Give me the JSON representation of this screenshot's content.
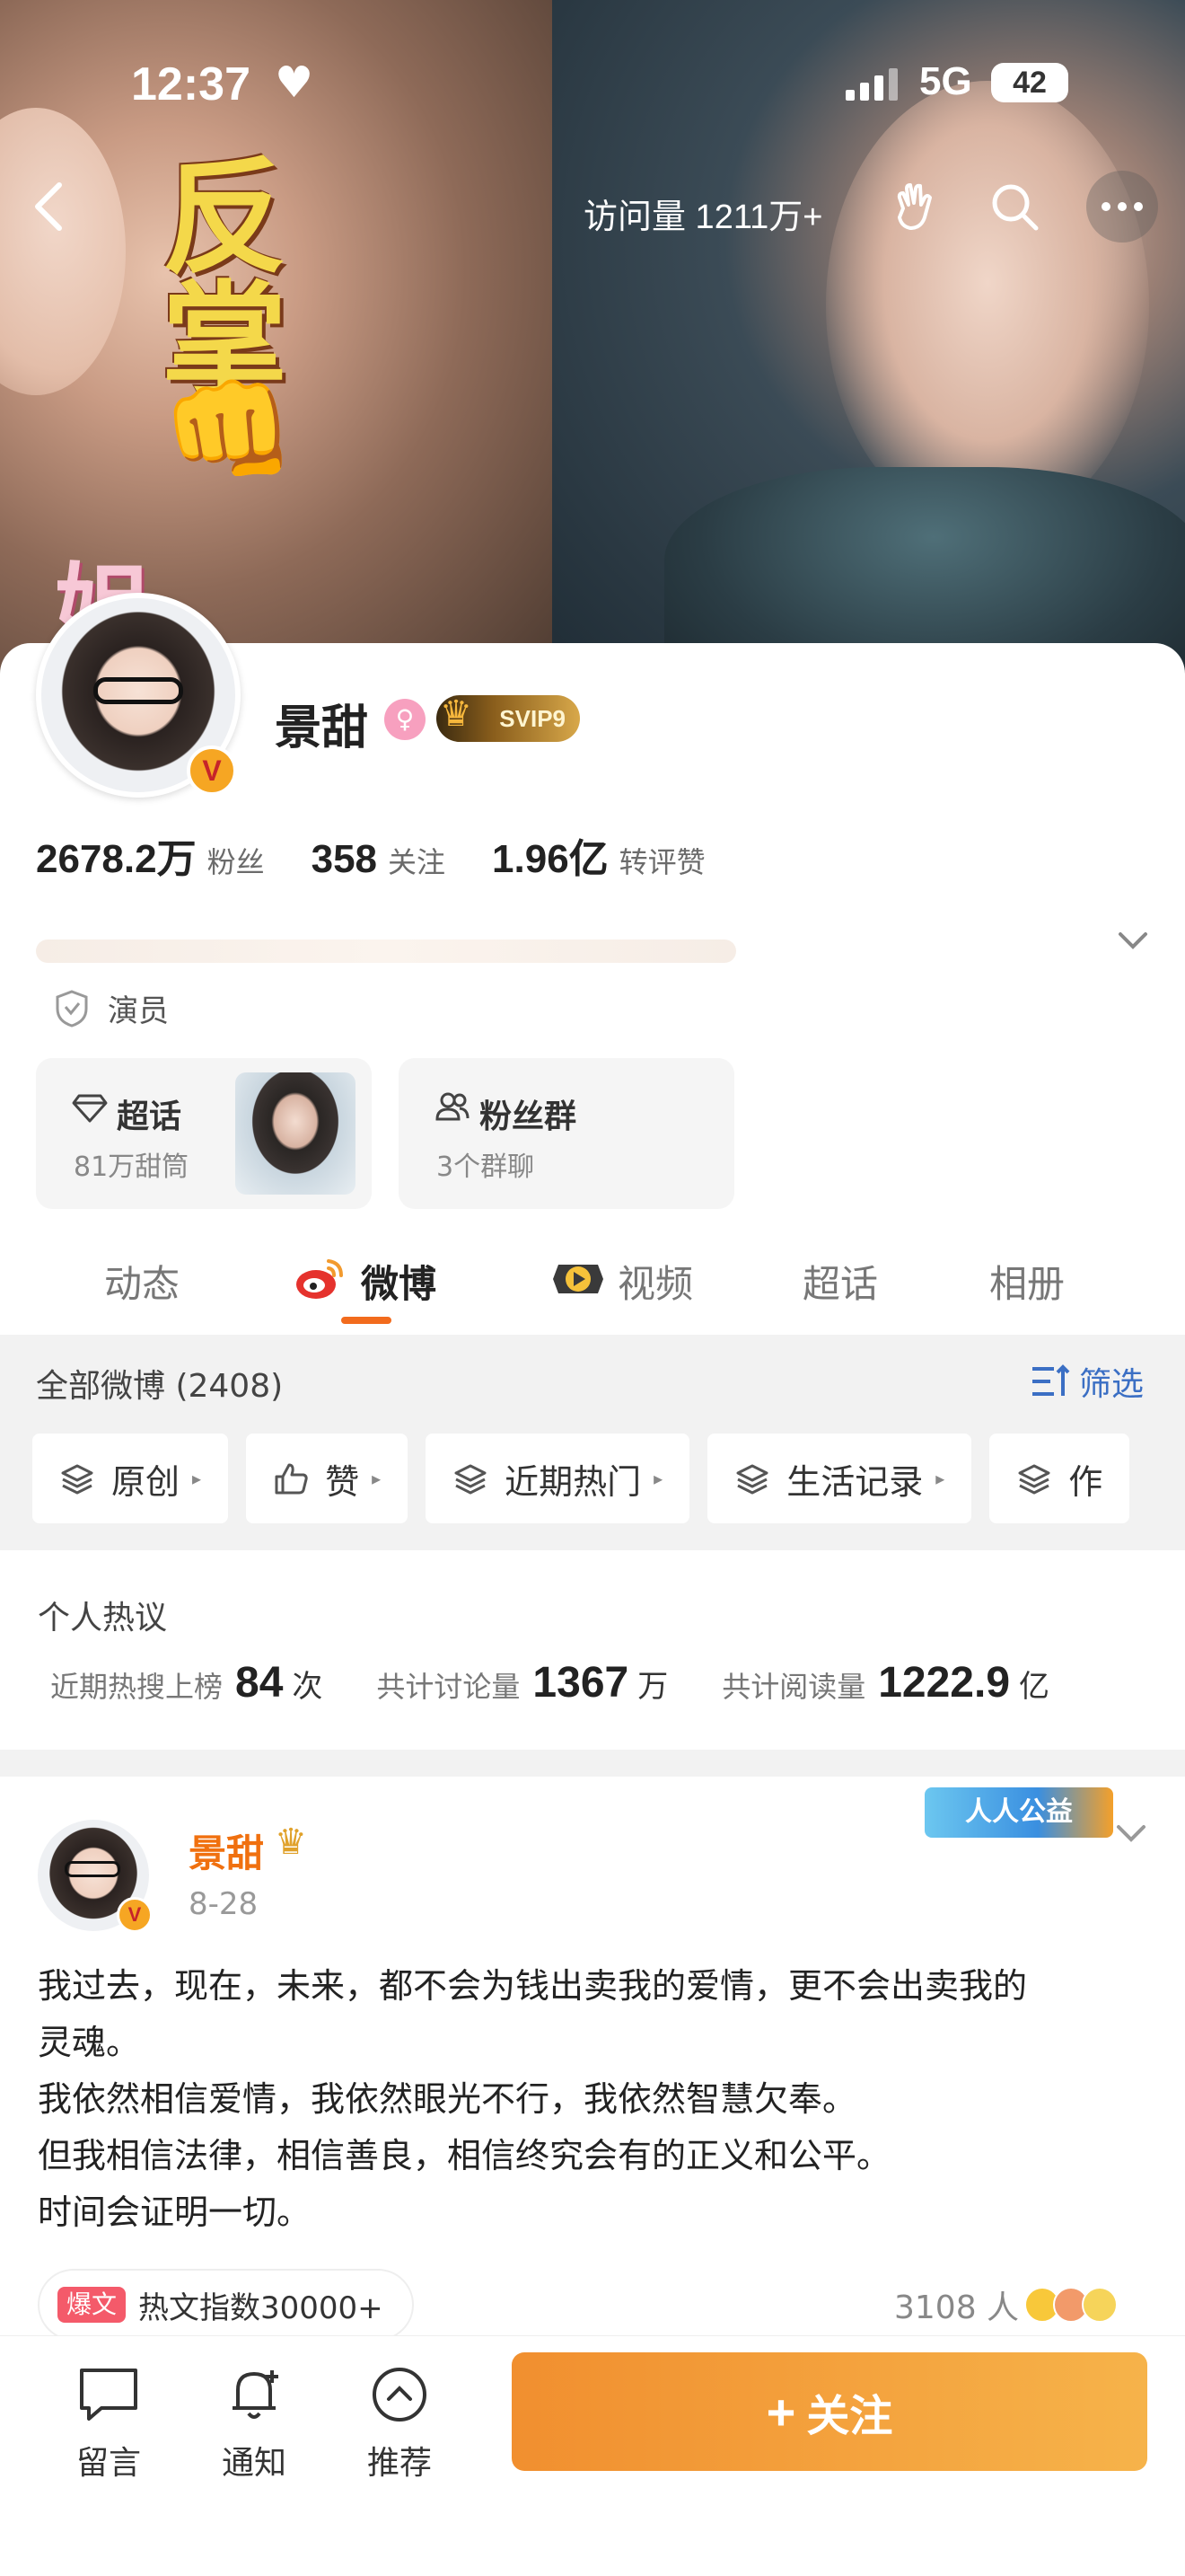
{
  "status_bar": {
    "time": "12:37",
    "network": "5G",
    "battery": "42"
  },
  "header": {
    "visits": "访问量 1211万+",
    "cover_chars": [
      "反",
      "掌",
      "姐"
    ]
  },
  "profile": {
    "name": "景甜",
    "vip_badge": "SVIP9",
    "verified_mark": "V",
    "stats": [
      {
        "value": "2678.2万",
        "label": "粉丝"
      },
      {
        "value": "358",
        "label": "关注"
      },
      {
        "value": "1.96亿",
        "label": "转评赞"
      }
    ],
    "tag": "演员",
    "cards": [
      {
        "title": "超话",
        "sub": "81万甜筒"
      },
      {
        "title": "粉丝群",
        "sub": "3个群聊"
      }
    ]
  },
  "tabs": [
    "动态",
    "微博",
    "视频",
    "超话",
    "相册"
  ],
  "active_tab": "微博",
  "filter": {
    "all_posts": "全部微博 (2408)",
    "filter_label": "筛选",
    "chips": [
      "原创",
      "赞",
      "近期热门",
      "生活记录",
      "作"
    ]
  },
  "heat": {
    "title": "个人热议",
    "items": [
      {
        "label": "近期热搜上榜",
        "value": "84",
        "unit": "次"
      },
      {
        "label": "共计讨论量",
        "value": "1367",
        "unit": "万"
      },
      {
        "label": "共计阅读量",
        "value": "1222.9",
        "unit": "亿"
      }
    ]
  },
  "post": {
    "author": "景甜",
    "date": "8-28",
    "charity": "人人公益",
    "lines": [
      "我过去，现在，未来，都不会为钱出卖我的爱情，更不会出卖我的",
      "灵魂。",
      "我依然相信爱情，我依然眼光不行，我依然智慧欠奉。",
      "但我相信法律，相信善良，相信终究会有的正义和公平。",
      "时间会证明一切。"
    ],
    "hot_badge": "爆文",
    "hot_text": "热文指数30000+",
    "reaction_count": "3108 人"
  },
  "bottom_bar": {
    "items": [
      "留言",
      "通知",
      "推荐"
    ],
    "follow": "关注",
    "follow_plus": "+"
  }
}
